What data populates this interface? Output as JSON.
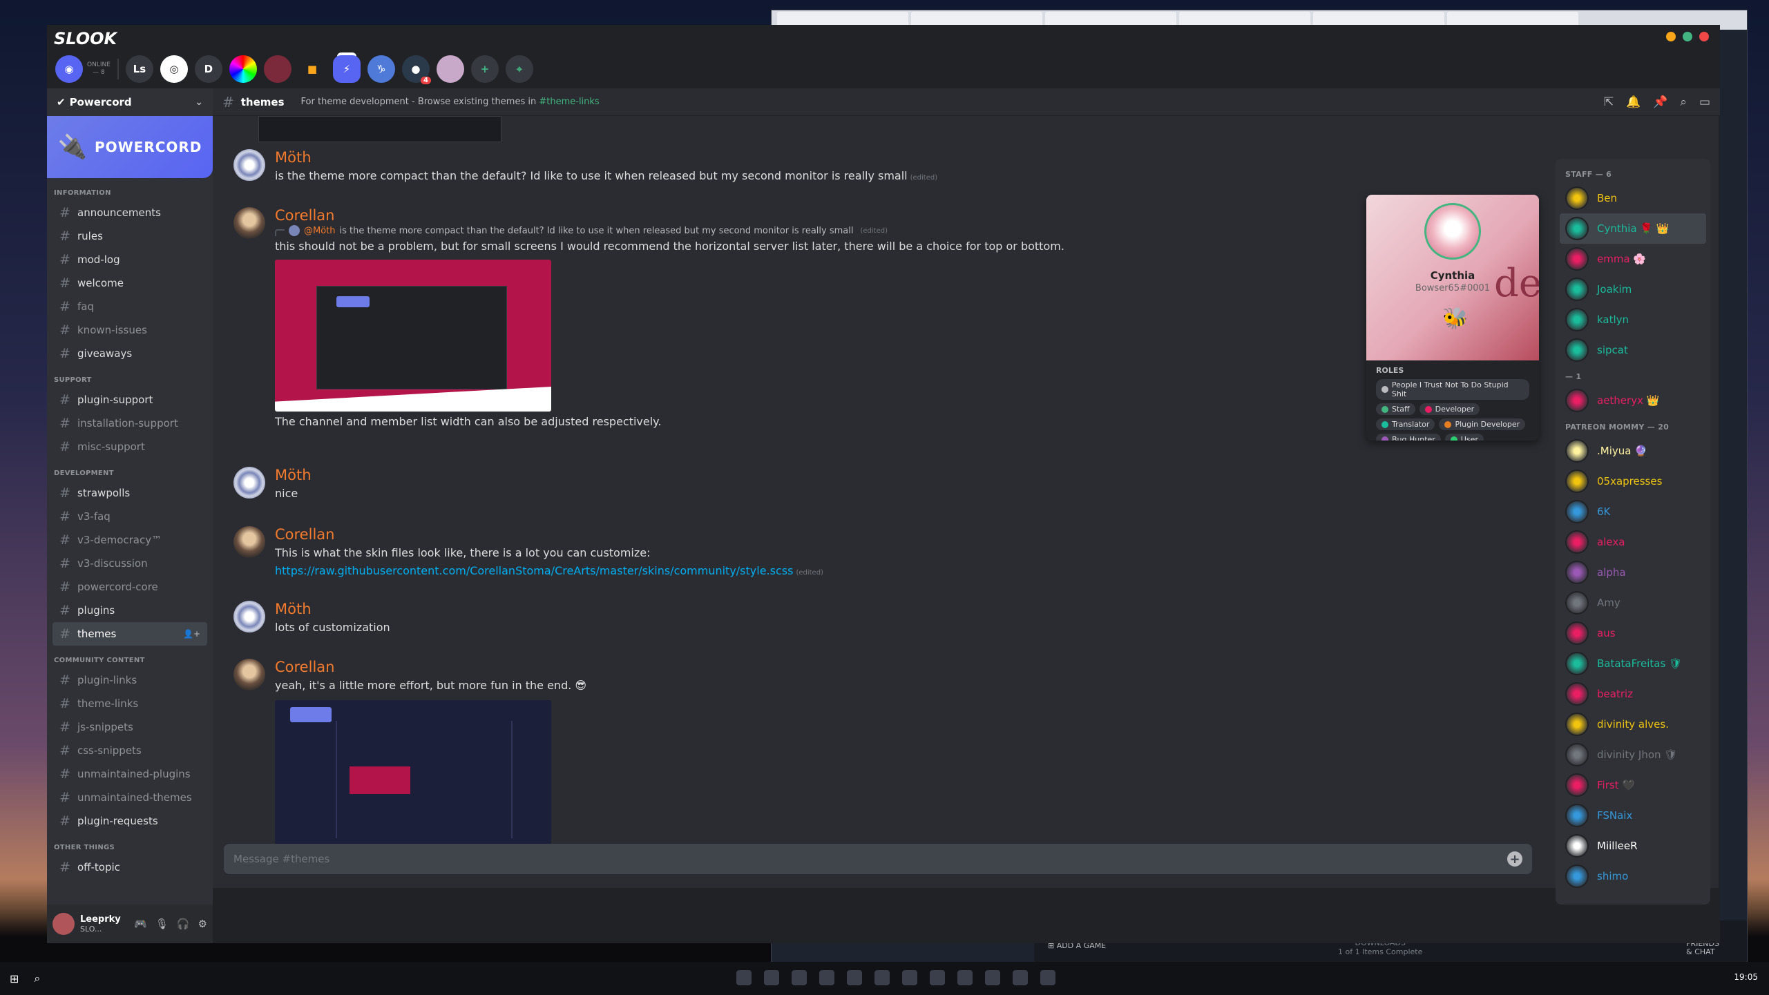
{
  "app": {
    "brand": "SLOOK"
  },
  "servers": {
    "online_label": "ONLINE",
    "online_count": "— 8",
    "items": [
      {
        "label": "Ls"
      },
      {
        "label": "D"
      },
      {
        "label": "",
        "badge": "4"
      }
    ],
    "add_label": "+",
    "explore_label": "⌖"
  },
  "sidebar": {
    "guild_name": "Powercord",
    "banner_text": "POWERCORD",
    "categories": [
      {
        "name": "INFORMATION",
        "channels": [
          "announcements",
          "rules",
          "mod-log",
          "welcome",
          "faq",
          "known-issues",
          "giveaways"
        ]
      },
      {
        "name": "SUPPORT",
        "channels": [
          "plugin-support",
          "installation-support",
          "misc-support"
        ]
      },
      {
        "name": "DEVELOPMENT",
        "channels": [
          "strawpolls",
          "v3-faq",
          "v3-democracy™",
          "v3-discussion",
          "powercord-core",
          "plugins",
          "themes"
        ]
      },
      {
        "name": "COMMUNITY CONTENT",
        "channels": [
          "plugin-links",
          "theme-links",
          "js-snippets",
          "css-snippets",
          "unmaintained-plugins",
          "unmaintained-themes",
          "plugin-requests"
        ]
      },
      {
        "name": "OTHER THINGS",
        "channels": [
          "off-topic"
        ]
      }
    ]
  },
  "user": {
    "name": "Leeprky",
    "tag": "SLO..."
  },
  "header": {
    "channel": "themes",
    "topic": "For theme development - Browse existing themes in",
    "topic_link": "#theme-links"
  },
  "messages": [
    {
      "author": "Möth",
      "text": "is the theme more compact than the default? Id like to use it when released but my second monitor is really small",
      "edited": "(edited)"
    },
    {
      "author": "Corellan",
      "reply_name": "@Möth",
      "reply_text": "is the theme more compact than the default? Id like to use it when released but my second monitor is really small",
      "reply_edited": "(edited)",
      "text": "this should not be a problem, but for small screens I would recommend the horizontal server list later, there will be a choice for top or bottom.",
      "text2": "The channel and member list width can also be adjusted respectively."
    },
    {
      "author": "Möth",
      "text": "nice"
    },
    {
      "author": "Corellan",
      "text": "This is what the skin files look like, there is a lot you can customize:",
      "link": "https://raw.githubusercontent.com/CorellanStoma/CreArts/master/skins/community/style.scss",
      "edited": "(edited)"
    },
    {
      "author": "Möth",
      "text": "lots of customization"
    },
    {
      "author": "Corellan",
      "text": "yeah, it's a little more effort, but more fun in the end. 😎"
    }
  ],
  "composer": {
    "placeholder": "Message #themes"
  },
  "popout": {
    "name": "Cynthia",
    "tag": "Bowser65#0001",
    "bg_text": "de",
    "roles_title": "ROLES",
    "roles": [
      {
        "name": "People I Trust Not To Do Stupid Shit",
        "color": "#b9bbbe"
      },
      {
        "name": "Staff",
        "color": "#43b581"
      },
      {
        "name": "Developer",
        "color": "#e91e63"
      },
      {
        "name": "Translator",
        "color": "#1abc9c"
      },
      {
        "name": "Plugin Developer",
        "color": "#e67e22"
      },
      {
        "name": "Bug Hunter",
        "color": "#9b59b6"
      },
      {
        "name": "User",
        "color": "#2ecc71"
      }
    ]
  },
  "members": {
    "groups": [
      {
        "title": "STAFF — 6",
        "items": [
          {
            "name": "Ben",
            "color": "#f1c40f"
          },
          {
            "name": "Cynthia 🌹 👑",
            "color": "#1abc9c"
          },
          {
            "name": "emma 🌸",
            "color": "#e91e63"
          },
          {
            "name": "Joakim",
            "color": "#1abc9c"
          },
          {
            "name": "katlyn",
            "color": "#1abc9c"
          },
          {
            "name": "sipcat",
            "color": "#1abc9c"
          }
        ]
      },
      {
        "title": "— 1",
        "items": [
          {
            "name": "aetheryx 👑",
            "color": "#e91e63"
          }
        ]
      },
      {
        "title": "PATREON MOMMY — 20",
        "items": [
          {
            "name": ".Miyua 🔮",
            "color": "#fff3a0"
          },
          {
            "name": "05xapresses",
            "color": "#f1c40f"
          },
          {
            "name": "6K",
            "color": "#3498db"
          },
          {
            "name": "alexa",
            "color": "#e91e63"
          },
          {
            "name": "alpha",
            "color": "#9b59b6"
          },
          {
            "name": "Amy",
            "color": "#72767d"
          },
          {
            "name": "aus",
            "color": "#e91e63"
          },
          {
            "name": "BatataFreitas 🛡",
            "color": "#1abc9c"
          },
          {
            "name": "beatriz",
            "color": "#e91e63"
          },
          {
            "name": "divinity alves.",
            "color": "#f1c40f"
          },
          {
            "name": "divinity Jhon 🛡",
            "color": "#72767d"
          },
          {
            "name": "First 🖤",
            "color": "#e91e63"
          },
          {
            "name": "FSNaix",
            "color": "#3498db"
          },
          {
            "name": "MiilleeR",
            "color": "#ffffff"
          },
          {
            "name": "shimo",
            "color": "#3498db"
          }
        ]
      }
    ]
  },
  "steam": {
    "add_game": "ADD A GAME",
    "downloads": "DOWNLOADS",
    "downloads_status": "1 of 1 Items Complete",
    "friends_1": "FRIENDS",
    "friends_2": "& CHAT"
  },
  "taskbar": {
    "time": "19:05"
  }
}
